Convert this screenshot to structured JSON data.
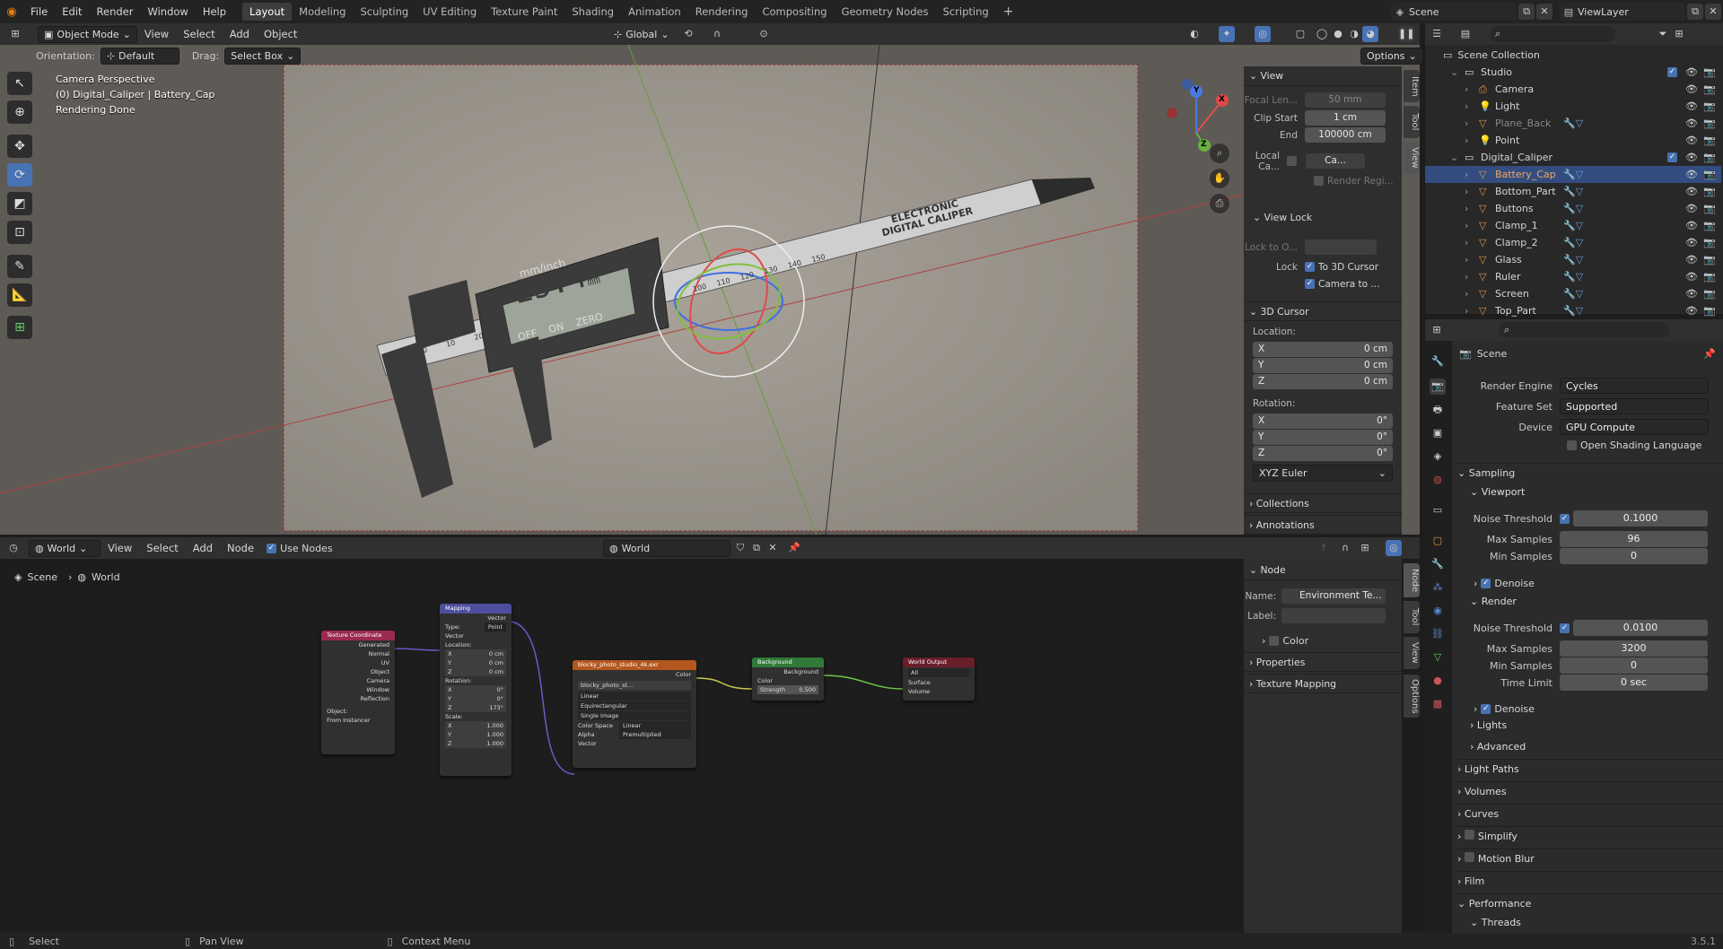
{
  "app": {
    "menus": [
      "File",
      "Edit",
      "Render",
      "Window",
      "Help"
    ],
    "workspaces": [
      "Layout",
      "Modeling",
      "Sculpting",
      "UV Editing",
      "Texture Paint",
      "Shading",
      "Animation",
      "Rendering",
      "Compositing",
      "Geometry Nodes",
      "Scripting"
    ],
    "active_workspace": "Layout",
    "add_workspace": "+",
    "scene_name": "Scene",
    "view_layer": "ViewLayer"
  },
  "viewport_header": {
    "mode": "Object Mode",
    "menus": [
      "View",
      "Select",
      "Add",
      "Object"
    ],
    "transform_orientation": "Global",
    "orientation_label": "Orientation:",
    "orientation_value": "Default",
    "drag_label": "Drag:",
    "drag_value": "Select Box",
    "options": "Options"
  },
  "viewport": {
    "line1": "Camera Perspective",
    "line2": "(0) Digital_Caliper | Battery_Cap",
    "line3": "Rendering Done",
    "caliper_text": [
      "ELECTRONIC",
      "DIGITAL CALIPER"
    ],
    "display_value": "25.4",
    "display_unit": "mm",
    "display_header": "mm/inch",
    "button_labels": [
      "OFF",
      "ON",
      "ZERO"
    ],
    "ruler_numbers": [
      "0",
      "10",
      "20",
      "100",
      "110",
      "120",
      "130",
      "140",
      "150"
    ],
    "gizmo": {
      "x": "X",
      "y": "Y",
      "z": "Z"
    }
  },
  "npanel": {
    "tabs": [
      "Item",
      "Tool",
      "View"
    ],
    "active_tab": "View",
    "view_section": "View",
    "focal_label": "Focal Len...",
    "focal_value": "50 mm",
    "clip_start_label": "Clip Start",
    "clip_start_value": "1 cm",
    "clip_end_label": "End",
    "clip_end_value": "100000 cm",
    "local_camera_label": "Local Ca...",
    "local_camera_value": "Ca...",
    "render_region": "Render Regi...",
    "view_lock_section": "View Lock",
    "lock_to_object": "Lock to O...",
    "lock_label": "Lock",
    "to_3d_cursor": "To 3D Cursor",
    "camera_to": "Camera to ...",
    "cursor_section": "3D Cursor",
    "location_label": "Location:",
    "loc": [
      {
        "axis": "X",
        "value": "0 cm"
      },
      {
        "axis": "Y",
        "value": "0 cm"
      },
      {
        "axis": "Z",
        "value": "0 cm"
      }
    ],
    "rotation_label": "Rotation:",
    "rot": [
      {
        "axis": "X",
        "value": "0°"
      },
      {
        "axis": "Y",
        "value": "0°"
      },
      {
        "axis": "Z",
        "value": "0°"
      }
    ],
    "rotation_mode": "XYZ Euler",
    "collections": "Collections",
    "annotations": "Annotations"
  },
  "outliner": {
    "root": "Scene Collection",
    "items": [
      {
        "name": "Studio",
        "level": 1,
        "type": "collection"
      },
      {
        "name": "Camera",
        "level": 2,
        "type": "camera"
      },
      {
        "name": "Light",
        "level": 2,
        "type": "light"
      },
      {
        "name": "Plane_Back",
        "level": 2,
        "type": "mesh"
      },
      {
        "name": "Point",
        "level": 2,
        "type": "light"
      },
      {
        "name": "Digital_Caliper",
        "level": 1,
        "type": "collection"
      },
      {
        "name": "Battery_Cap",
        "level": 2,
        "type": "mesh",
        "selected": true
      },
      {
        "name": "Bottom_Part",
        "level": 2,
        "type": "mesh"
      },
      {
        "name": "Buttons",
        "level": 2,
        "type": "mesh"
      },
      {
        "name": "Clamp_1",
        "level": 2,
        "type": "mesh"
      },
      {
        "name": "Clamp_2",
        "level": 2,
        "type": "mesh"
      },
      {
        "name": "Glass",
        "level": 2,
        "type": "mesh"
      },
      {
        "name": "Ruler",
        "level": 2,
        "type": "mesh"
      },
      {
        "name": "Screen",
        "level": 2,
        "type": "mesh"
      },
      {
        "name": "Top_Part",
        "level": 2,
        "type": "mesh"
      }
    ]
  },
  "properties": {
    "context": "Scene",
    "render_engine_label": "Render Engine",
    "render_engine": "Cycles",
    "feature_set_label": "Feature Set",
    "feature_set": "Supported",
    "device_label": "Device",
    "device": "GPU Compute",
    "osl": "Open Shading Language",
    "sampling": "Sampling",
    "viewport": "Viewport",
    "noise_threshold_label": "Noise Threshold",
    "vp_noise": "0.1000",
    "max_samples_label": "Max Samples",
    "vp_max": "96",
    "min_samples_label": "Min Samples",
    "vp_min": "0",
    "denoise": "Denoise",
    "render": "Render",
    "r_noise": "0.0100",
    "r_max": "3200",
    "r_min": "0",
    "time_limit_label": "Time Limit",
    "r_time": "0 sec",
    "lights": "Lights",
    "advanced": "Advanced",
    "light_paths": "Light Paths",
    "volumes": "Volumes",
    "curves": "Curves",
    "simplify": "Simplify",
    "motion_blur": "Motion Blur",
    "film": "Film",
    "performance": "Performance",
    "threads": "Threads"
  },
  "node_editor": {
    "type": "World",
    "menus": [
      "View",
      "Select",
      "Add",
      "Node"
    ],
    "use_nodes": "Use Nodes",
    "world_name": "World",
    "breadcrumb": [
      "Scene",
      "World"
    ],
    "panel_tabs": [
      "Node",
      "Tool",
      "View",
      "Options"
    ],
    "node_section": "Node",
    "name_label": "Name:",
    "name_value": "Environment Te...",
    "label_label": "Label:",
    "color": "Color",
    "properties": "Properties",
    "texture_mapping": "Texture Mapping"
  },
  "nodes": {
    "texcoord": {
      "title": "Texture Coordinate",
      "outputs": [
        "Generated",
        "Normal",
        "UV",
        "Object",
        "Camera",
        "Window",
        "Reflection"
      ],
      "object_label": "Object:",
      "from_instancer": "From Instancer"
    },
    "mapping": {
      "title": "Mapping",
      "output": "Vector",
      "type_label": "Type:",
      "type_value": "Point",
      "vector": "Vector",
      "location": "Location:",
      "loc": [
        "0 cm",
        "0 cm",
        "0 cm"
      ],
      "rotation": "Rotation:",
      "rot": [
        "0°",
        "0°",
        "173°"
      ],
      "scale": "Scale:",
      "scl": [
        "1.000",
        "1.000",
        "1.000"
      ],
      "axes": [
        "X",
        "Y",
        "Z"
      ]
    },
    "envtex": {
      "title": "blocky_photo_studio_4k.exr",
      "output": "Color",
      "image": "blocky_photo_st...",
      "interp": "Linear",
      "proj": "Equirectangular",
      "src": "Single Image",
      "cs_label": "Color Space",
      "cs": "Linear",
      "alpha_label": "Alpha",
      "alpha": "Premultiplied",
      "vector": "Vector"
    },
    "background": {
      "title": "Background",
      "output": "Background",
      "color": "Color",
      "strength_label": "Strength",
      "strength": "0.500"
    },
    "output": {
      "title": "World Output",
      "target": "All",
      "surface": "Surface",
      "volume": "Volume"
    }
  },
  "status": {
    "select": "Select",
    "pan": "Pan View",
    "context": "Context Menu",
    "version": "3.5.1"
  },
  "colors": {
    "accent": "#4772b3",
    "selected_row": "#334d80",
    "mesh_icon": "#e8954a",
    "texcoord_header": "#9a2a52",
    "mapping_header": "#4e4e9e",
    "env_header": "#b4571e",
    "bg_header": "#2f7a38",
    "out_header": "#6a1e2a"
  }
}
